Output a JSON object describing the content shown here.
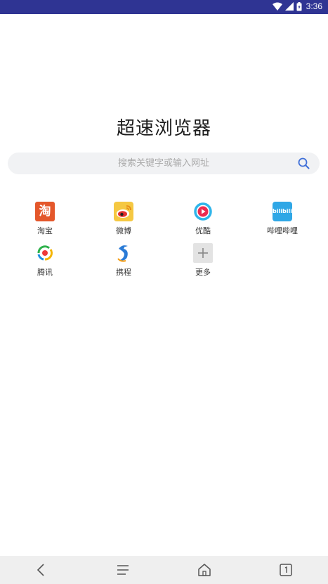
{
  "status": {
    "time": "3:36"
  },
  "app": {
    "title": "超速浏览器"
  },
  "search": {
    "placeholder": "搜索关键字或输入网址"
  },
  "shortcuts": [
    {
      "label": "淘宝",
      "icon": "taobao-icon",
      "glyph": "淘"
    },
    {
      "label": "微博",
      "icon": "weibo-icon"
    },
    {
      "label": "优酷",
      "icon": "youku-icon"
    },
    {
      "label": "哔哩哔哩",
      "icon": "bilibili-icon",
      "glyph": "bilibili"
    },
    {
      "label": "腾讯",
      "icon": "tencent-icon"
    },
    {
      "label": "携程",
      "icon": "ctrip-icon"
    },
    {
      "label": "更多",
      "icon": "add-icon"
    }
  ],
  "colors": {
    "status_bar": "#2f3493",
    "accent": "#3f6fd8",
    "taobao": "#e4572b",
    "weibo": "#f5c842",
    "youku": "#2fb5ea",
    "bilibili": "#2fa7e6"
  }
}
